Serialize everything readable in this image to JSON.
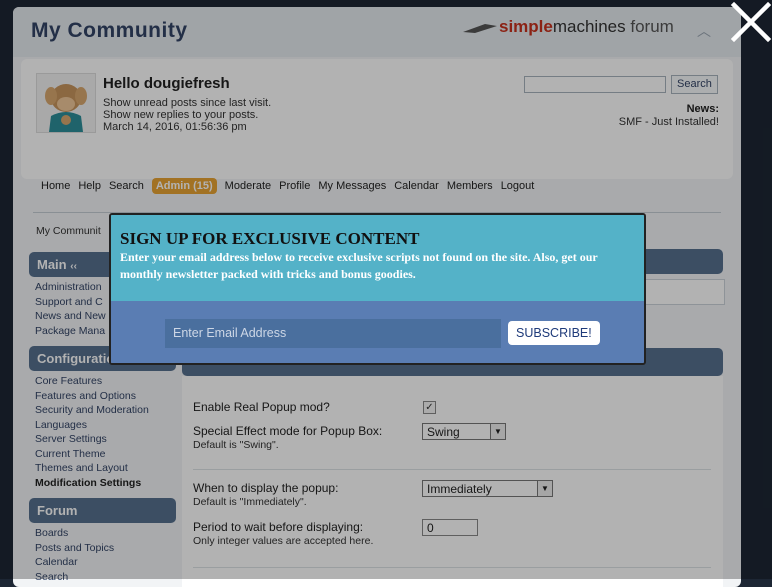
{
  "forum": {
    "title": "My Community",
    "logo_part1": "simple",
    "logo_part2": "machines",
    "logo_part3": "forum"
  },
  "user": {
    "greeting": "Hello dougiefresh",
    "line1": "Show unread posts since last visit.",
    "line2": "Show new replies to your posts.",
    "datetime": "March 14, 2016, 01:56:36 pm"
  },
  "search": {
    "button": "Search"
  },
  "news": {
    "label": "News:",
    "text": "SMF - Just Installed!"
  },
  "menu": [
    "Home",
    "Help",
    "Search",
    "Admin (15)",
    "Moderate",
    "Profile",
    "My Messages",
    "Calendar",
    "Members",
    "Logout"
  ],
  "breadcrumb": "My Communit",
  "sidebar": {
    "main_title": "Main",
    "main_items": [
      "Administration",
      "Support and C",
      "News and New",
      "Package Mana"
    ],
    "config_title": "Configuratio",
    "config_items": [
      "Core Features",
      "Features and Options",
      "Security and Moderation",
      "Languages",
      "Server Settings",
      "Current Theme",
      "Themes and Layout",
      "Modification Settings"
    ],
    "forum_title": "Forum",
    "forum_items": [
      "Boards",
      "Posts and Topics",
      "Calendar",
      "Search"
    ]
  },
  "settings": {
    "enable_label": "Enable Real Popup mod?",
    "enable_checked": true,
    "effect_label": "Special Effect mode for Popup Box:",
    "effect_default": "Default is \"Swing\".",
    "effect_value": "Swing",
    "when_label": "When to display the popup:",
    "when_default": "Default is \"Immediately\".",
    "when_value": "Immediately",
    "period_label": "Period to wait before displaying:",
    "period_note": "Only integer values are accepted here.",
    "period_value": "0"
  },
  "modal": {
    "title": "SIGN UP FOR EXCLUSIVE CONTENT",
    "description": "Enter your email address below to receive exclusive scripts not found on the site. Also, get our monthly newsletter packed with tricks and bonus goodies.",
    "email_placeholder": "Enter Email Address",
    "subscribe": "SUBSCRIBE!"
  },
  "colors": {
    "accent": "#54b2c8",
    "modal_bottom": "#5a7db3",
    "admin_tab": "#e8a434",
    "header_bar": "#56708f"
  },
  "icons": {
    "close": "close-icon",
    "collapse": "collapse-icon",
    "dropdown": "chevron-down-icon"
  }
}
